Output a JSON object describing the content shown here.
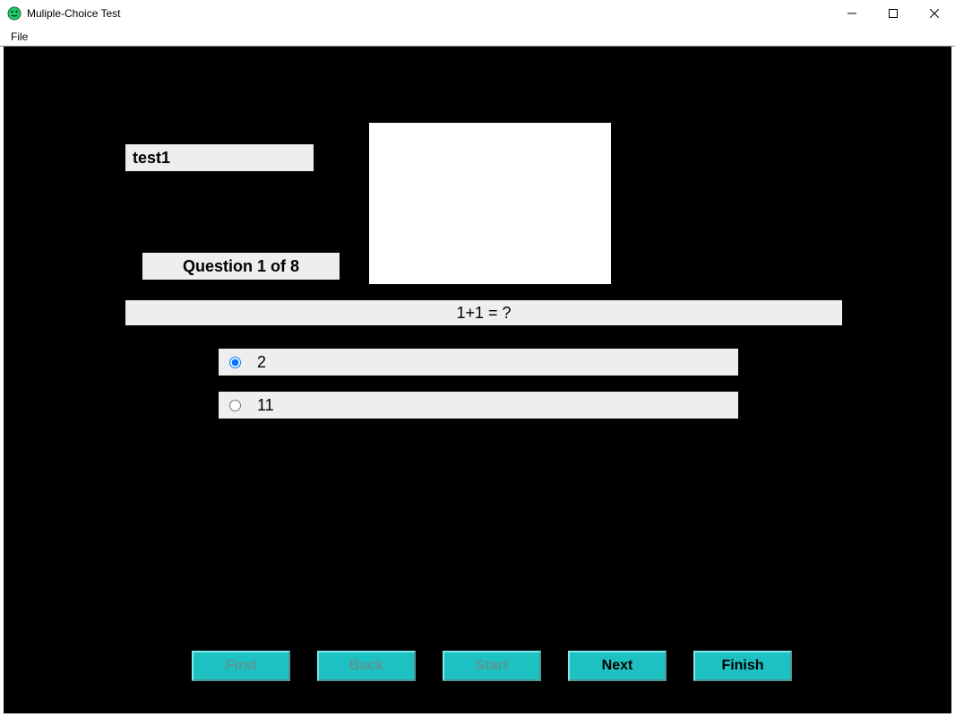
{
  "window": {
    "title": "Muliple-Choice Test"
  },
  "menu": {
    "file": "File"
  },
  "quiz": {
    "test_name": "test1",
    "counter": "Question 1 of 8",
    "question": "1+1 = ?",
    "answers": {
      "a1": "2",
      "a2": "11"
    },
    "selected_index": 0
  },
  "buttons": {
    "first": "First",
    "back": "Back",
    "start": "Start",
    "next": "Next",
    "finish": "Finish"
  },
  "button_states": {
    "first": "disabled",
    "back": "disabled",
    "start": "disabled",
    "next": "enabled",
    "finish": "enabled"
  }
}
